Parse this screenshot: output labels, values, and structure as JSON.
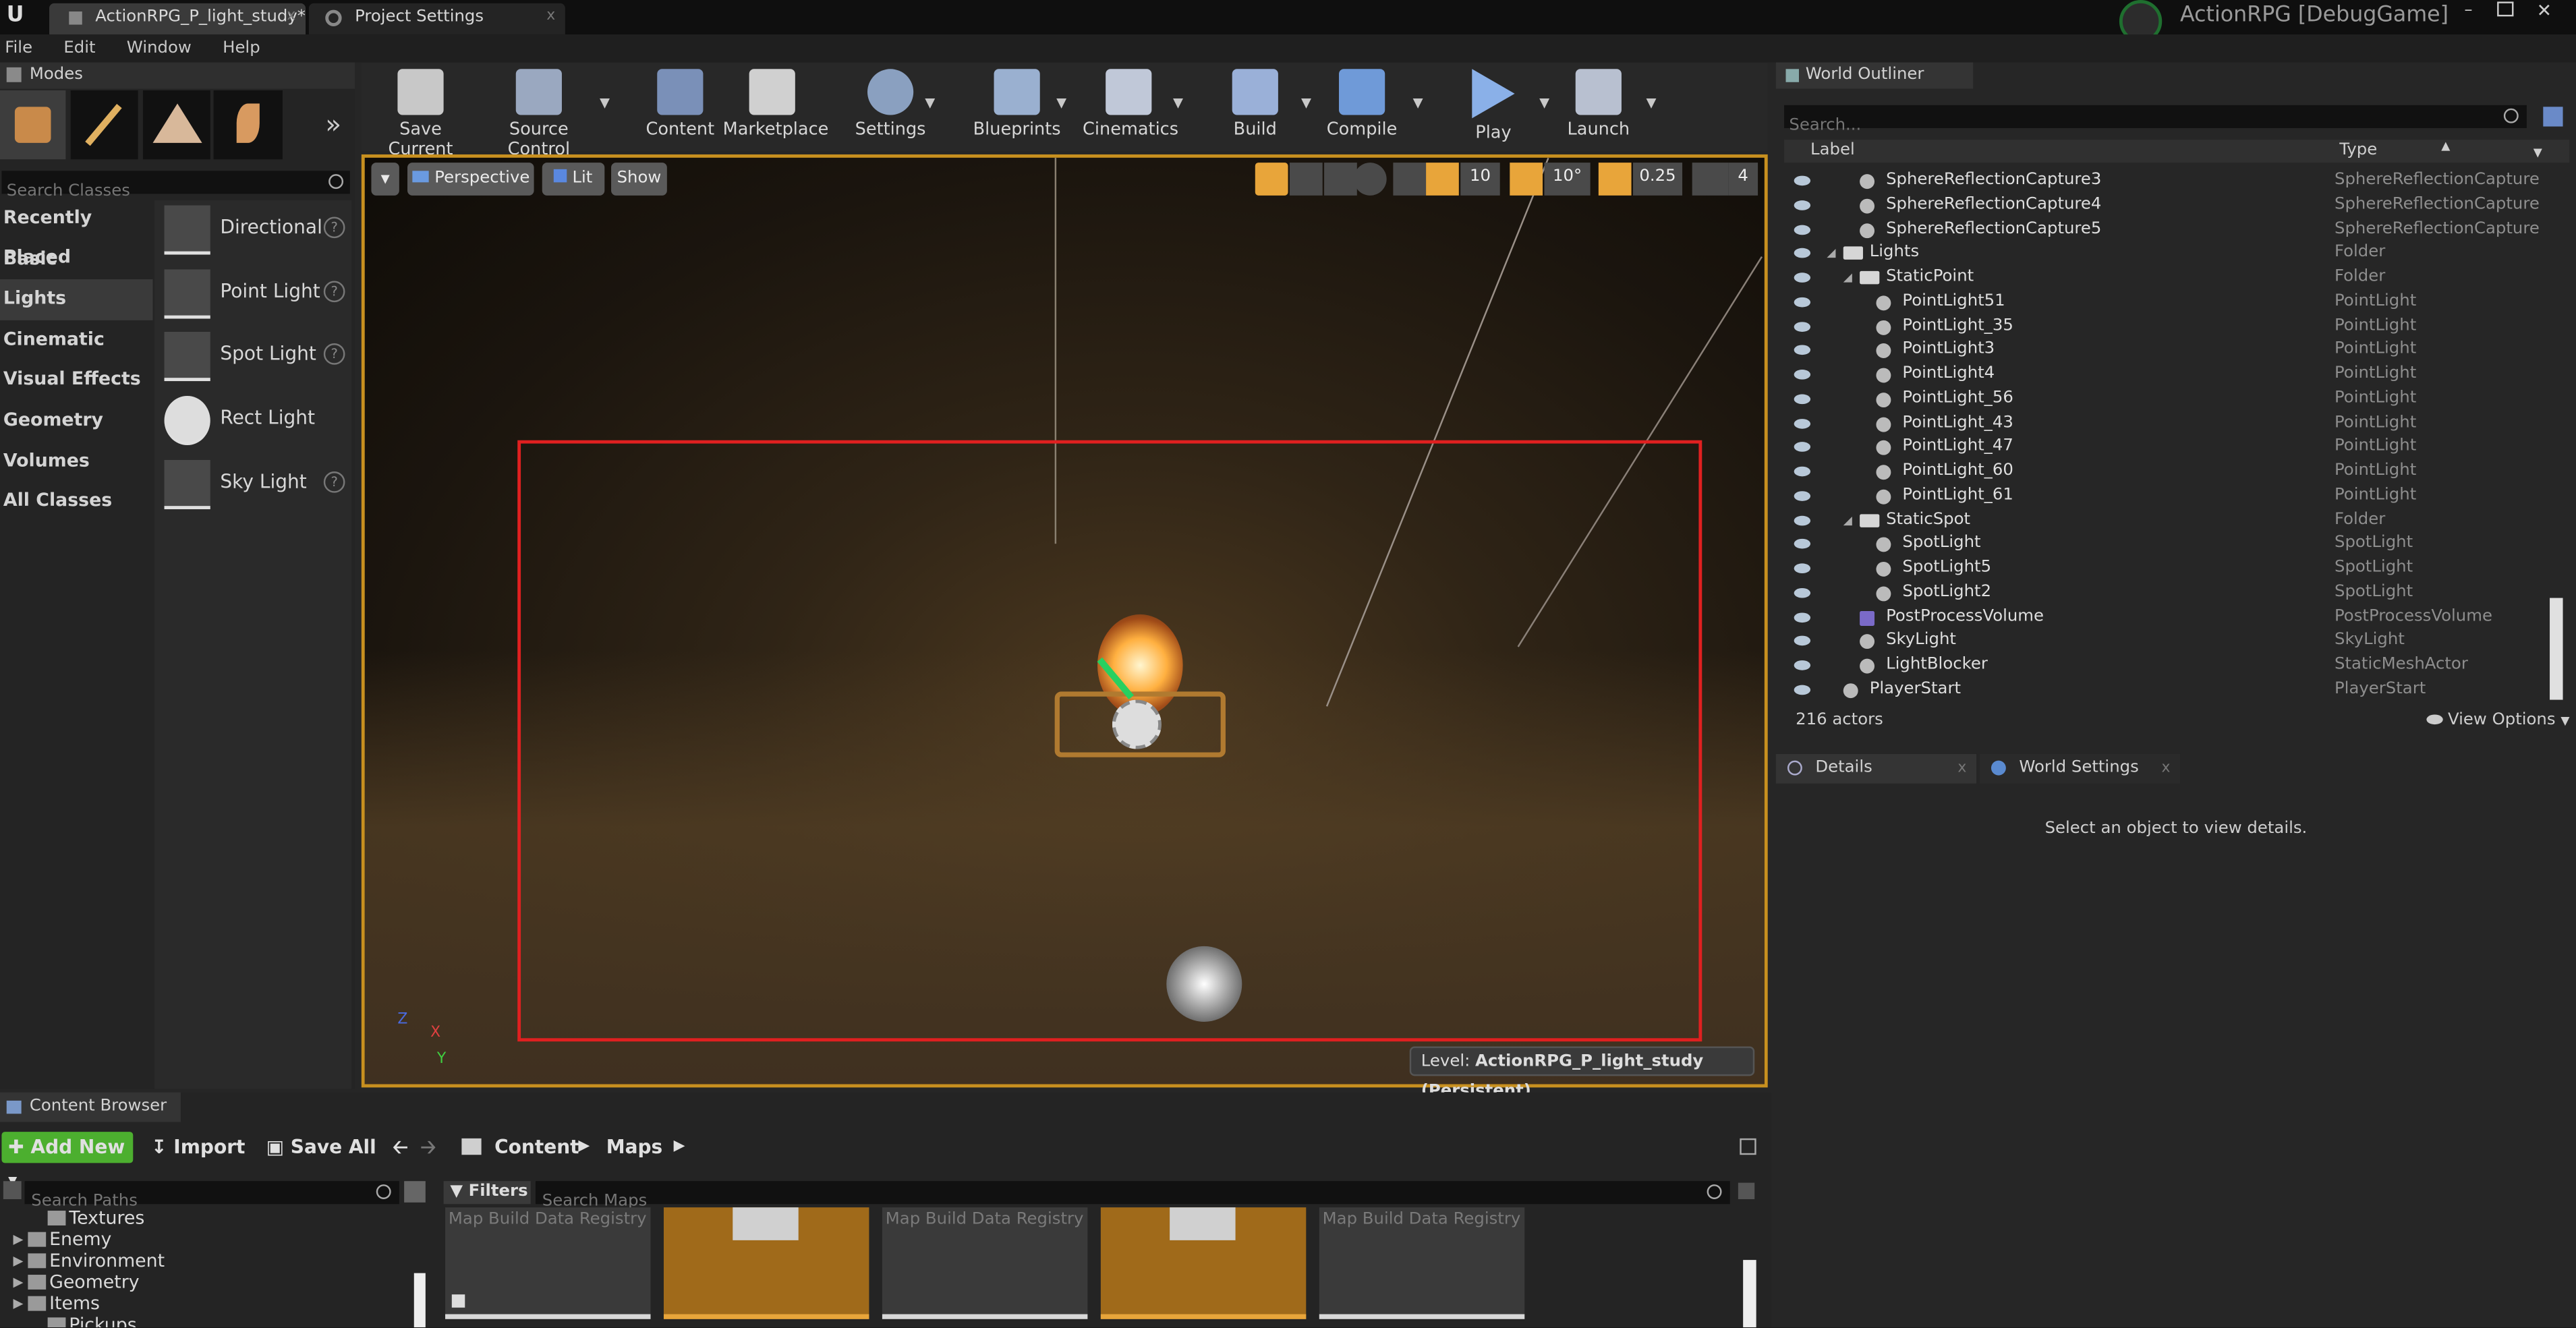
{
  "tabs": [
    {
      "label": "ActionRPG_P_light_study*"
    },
    {
      "label": "Project Settings"
    }
  ],
  "project": {
    "title": "ActionRPG [DebugGame]"
  },
  "menu": [
    "File",
    "Edit",
    "Window",
    "Help"
  ],
  "modes": {
    "header": "Modes",
    "search_placeholder": "Search Classes",
    "categories": [
      "Recently Placed",
      "Basic",
      "Lights",
      "Cinematic",
      "Visual Effects",
      "Geometry",
      "Volumes",
      "All Classes"
    ],
    "selected_category": "Lights",
    "lights": [
      "Directional",
      "Point Light",
      "Spot Light",
      "Rect Light",
      "Sky Light"
    ]
  },
  "toolbar": [
    "Save Current",
    "Source Control",
    "Content",
    "Marketplace",
    "Settings",
    "Blueprints",
    "Cinematics",
    "Build",
    "Compile",
    "Play",
    "Launch"
  ],
  "viewport": {
    "perspective": "Perspective",
    "lit": "Lit",
    "show": "Show",
    "grid_snap": "10",
    "rotation_snap": "10°",
    "scale_snap": "0.25",
    "camera_speed": "4",
    "level_label": "Level:",
    "level_name": "ActionRPG_P_light_study (Persistent)"
  },
  "outliner": {
    "header": "World Outliner",
    "search_placeholder": "Search...",
    "col_label": "Label",
    "col_type": "Type",
    "rows": [
      {
        "label": "SphereReflectionCapture3",
        "type": "SphereReflectionCapture",
        "icon": "reflection-icon",
        "depth": 2
      },
      {
        "label": "SphereReflectionCapture4",
        "type": "SphereReflectionCapture",
        "icon": "reflection-icon",
        "depth": 2
      },
      {
        "label": "SphereReflectionCapture5",
        "type": "SphereReflectionCapture",
        "icon": "reflection-icon",
        "depth": 2
      },
      {
        "label": "Lights",
        "type": "Folder",
        "icon": "folder-icon",
        "depth": 1
      },
      {
        "label": "StaticPoint",
        "type": "Folder",
        "icon": "folder-icon",
        "depth": 2
      },
      {
        "label": "PointLight51",
        "type": "PointLight",
        "icon": "bulb-icon",
        "depth": 3
      },
      {
        "label": "PointLight_35",
        "type": "PointLight",
        "icon": "bulb-icon",
        "depth": 3
      },
      {
        "label": "PointLight3",
        "type": "PointLight",
        "icon": "bulb-icon",
        "depth": 3
      },
      {
        "label": "PointLight4",
        "type": "PointLight",
        "icon": "bulb-icon",
        "depth": 3
      },
      {
        "label": "PointLight_56",
        "type": "PointLight",
        "icon": "bulb-icon",
        "depth": 3
      },
      {
        "label": "PointLight_43",
        "type": "PointLight",
        "icon": "bulb-icon",
        "depth": 3
      },
      {
        "label": "PointLight_47",
        "type": "PointLight",
        "icon": "bulb-icon",
        "depth": 3
      },
      {
        "label": "PointLight_60",
        "type": "PointLight",
        "icon": "bulb-icon",
        "depth": 3
      },
      {
        "label": "PointLight_61",
        "type": "PointLight",
        "icon": "bulb-icon",
        "depth": 3
      },
      {
        "label": "StaticSpot",
        "type": "Folder",
        "icon": "folder-icon",
        "depth": 2
      },
      {
        "label": "SpotLight",
        "type": "SpotLight",
        "icon": "spotlight-icon",
        "depth": 3
      },
      {
        "label": "SpotLight5",
        "type": "SpotLight",
        "icon": "spotlight-icon",
        "depth": 3
      },
      {
        "label": "SpotLight2",
        "type": "SpotLight",
        "icon": "spotlight-icon",
        "depth": 3
      },
      {
        "label": "PostProcessVolume",
        "type": "PostProcessVolume",
        "icon": "volume-icon",
        "depth": 2
      },
      {
        "label": "SkyLight",
        "type": "SkyLight",
        "icon": "skylight-icon",
        "depth": 2
      },
      {
        "label": "LightBlocker",
        "type": "StaticMeshActor",
        "icon": "mesh-icon",
        "depth": 2
      },
      {
        "label": "PlayerStart",
        "type": "PlayerStart",
        "icon": "playerstart-icon",
        "depth": 1
      }
    ],
    "actor_count": "216 actors",
    "view_options": "View Options"
  },
  "details": {
    "tab_details": "Details",
    "tab_world_settings": "World Settings",
    "empty_message": "Select an object to view details."
  },
  "content_browser": {
    "header": "Content Browser",
    "add_new": "Add New",
    "import": "Import",
    "save_all": "Save All",
    "breadcrumb": [
      "Content",
      "Maps"
    ],
    "search_paths_placeholder": "Search Paths",
    "filters": "Filters",
    "search_maps_placeholder": "Search Maps",
    "paths": [
      {
        "label": "Textures",
        "depth": 1
      },
      {
        "label": "Enemy",
        "depth": 0
      },
      {
        "label": "Environment",
        "depth": 0
      },
      {
        "label": "Geometry",
        "depth": 0
      },
      {
        "label": "Items",
        "depth": 0
      },
      {
        "label": "Pickups",
        "depth": 1
      }
    ],
    "tiles": [
      {
        "caption": "Map Build Data Registry",
        "selected": false
      },
      {
        "caption": "",
        "selected": true
      },
      {
        "caption": "Map Build Data Registry",
        "selected": false
      },
      {
        "caption": "",
        "selected": true
      },
      {
        "caption": "Map Build Data Registry",
        "selected": false
      }
    ]
  },
  "colors": {
    "accent_orange": "#e8a53a",
    "selection_red": "#e02020",
    "add_new_green": "#4caf2f"
  }
}
